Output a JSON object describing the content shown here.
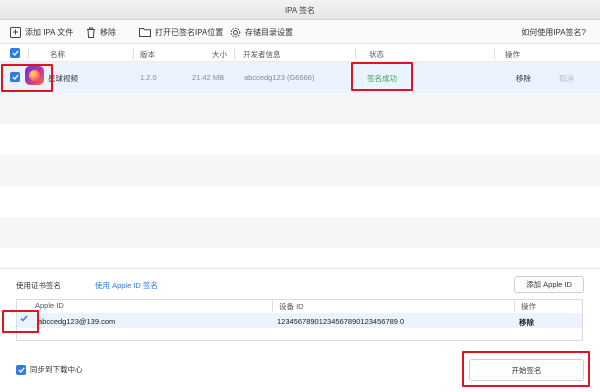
{
  "window": {
    "title": "IPA 签名"
  },
  "toolbar": {
    "add_ipa": "添加 IPA 文件",
    "remove": "移除",
    "open_location": "打开已签名IPA位置",
    "storage_settings": "存储目录设置",
    "help": "如何使用IPA签名?"
  },
  "table": {
    "headers": {
      "name": "名称",
      "version": "版本",
      "size": "大小",
      "developer": "开发者信息",
      "status": "状态",
      "actions": "操作"
    },
    "rows": [
      {
        "name": "星球视频",
        "version": "1.2.0",
        "size": "21.42 MB",
        "developer": "abccedg123 (G6666)",
        "status": "签名成功",
        "remove": "移除",
        "cancel": "取消"
      }
    ]
  },
  "signing": {
    "tab_cert": "使用证书签名",
    "tab_appleid": "使用 Apple ID 签名",
    "add_apple_id": "添加 Apple ID",
    "headers": {
      "apple_id": "Apple ID",
      "device_id": "设备 ID",
      "actions": "操作"
    },
    "rows": [
      {
        "apple_id": "abccedg123@139.com",
        "device_id": "12345678901234567890123456789 0",
        "remove": "移除"
      }
    ],
    "sync_label": "同步到下载中心",
    "start_button": "开始签名"
  },
  "colors": {
    "accent": "#2f7ae5",
    "success": "#2fa84f",
    "highlight": "#e0141e"
  }
}
